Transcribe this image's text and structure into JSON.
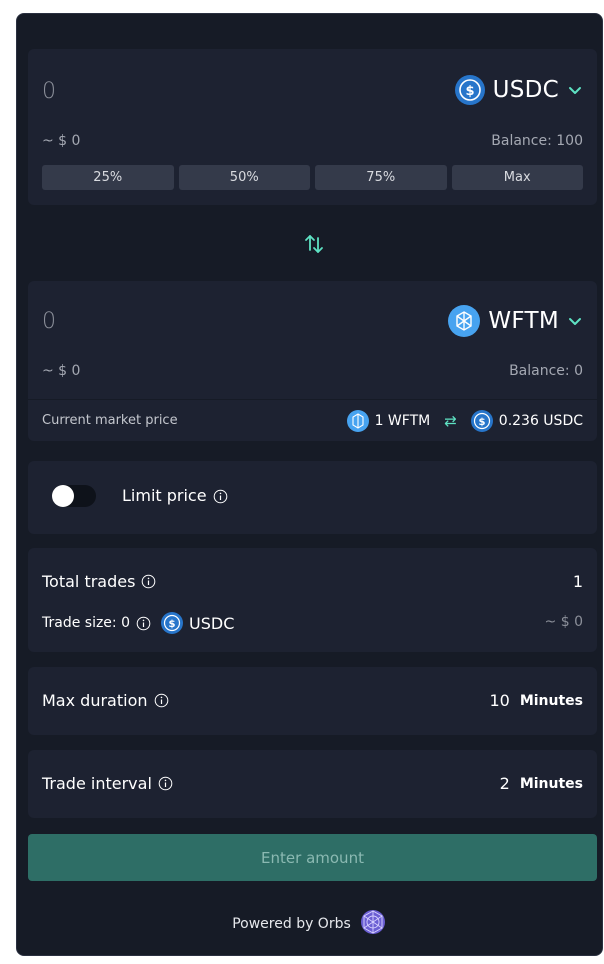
{
  "from": {
    "amount": "0",
    "token": "USDC",
    "usd_value": "~ $ 0",
    "balance": "Balance: 100",
    "percent_buttons": [
      "25%",
      "50%",
      "75%",
      "Max"
    ]
  },
  "to": {
    "amount": "0",
    "token": "WFTM",
    "usd_value": "~ $ 0",
    "balance": "Balance: 0"
  },
  "market": {
    "label": "Current market price",
    "left": "1 WFTM",
    "right": "0.236 USDC"
  },
  "limit": {
    "label": "Limit price",
    "enabled": false
  },
  "total_trades": {
    "label": "Total trades",
    "value": "1"
  },
  "trade_size": {
    "label": "Trade size: 0",
    "token": "USDC",
    "usd": "~ $ 0"
  },
  "max_duration": {
    "label": "Max duration",
    "value": "10",
    "unit": "Minutes"
  },
  "trade_interval": {
    "label": "Trade interval",
    "value": "2",
    "unit": "Minutes"
  },
  "cta": "Enter amount",
  "footer": "Powered by Orbs",
  "colors": {
    "accent": "#5ee2c3",
    "usdc": "#2775ca",
    "ftm": "#47a3f0",
    "cta_bg": "#2e6e66"
  }
}
